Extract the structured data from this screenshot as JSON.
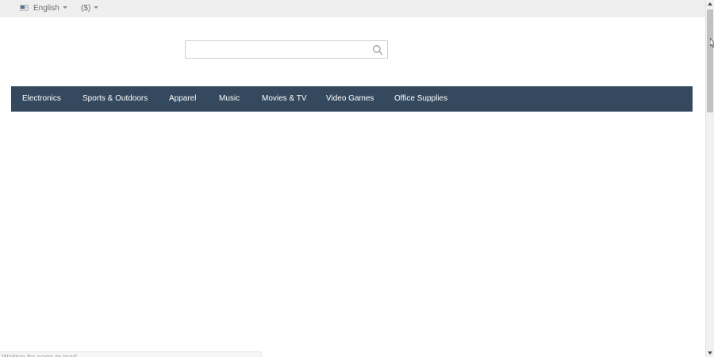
{
  "topbar": {
    "language_label": "English",
    "currency_label": "($)"
  },
  "search": {
    "value": "",
    "placeholder": "",
    "icon": "search-icon"
  },
  "nav": {
    "items": [
      {
        "label": "Electronics"
      },
      {
        "label": "Sports & Outdoors"
      },
      {
        "label": "Apparel"
      },
      {
        "label": "Music"
      },
      {
        "label": "Movies & TV"
      },
      {
        "label": "Video Games"
      },
      {
        "label": "Office Supplies"
      }
    ]
  },
  "statusbar": {
    "text": "Waiting for page to load..."
  },
  "colors": {
    "nav_background": "#34495e",
    "nav_text": "#ffffff",
    "topbar_background": "#efefef"
  }
}
